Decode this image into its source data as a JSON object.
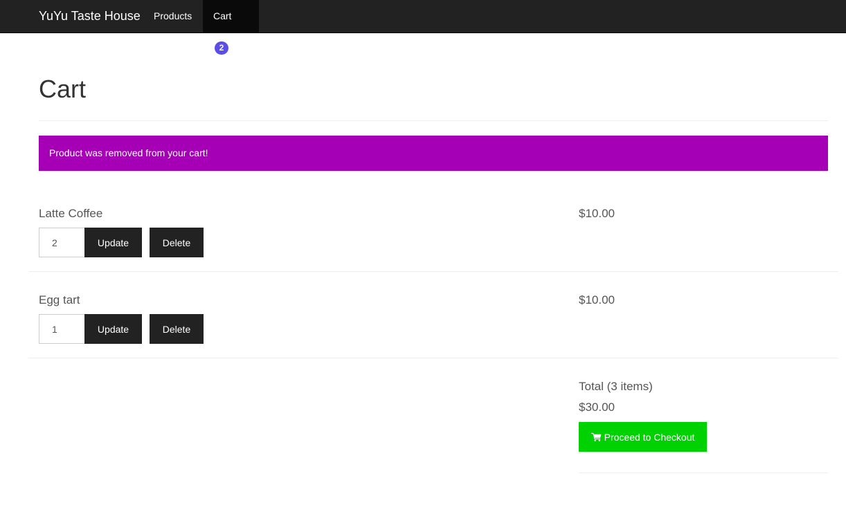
{
  "navbar": {
    "brand": "YuYu Taste House",
    "products_label": "Products",
    "cart_label": "Cart",
    "cart_count": "2"
  },
  "page": {
    "title": "Cart"
  },
  "alert": {
    "message": "Product was removed from your cart!",
    "color": "#a500b5"
  },
  "cart": {
    "items": [
      {
        "name": "Latte Coffee",
        "quantity": "2",
        "price": "$10.00",
        "update_label": "Update",
        "delete_label": "Delete"
      },
      {
        "name": "Egg tart",
        "quantity": "1",
        "price": "$10.00",
        "update_label": "Update",
        "delete_label": "Delete"
      }
    ],
    "total_label": "Total (3 items)",
    "total_value": "$30.00",
    "checkout_label": "Proceed to Checkout",
    "checkout_icon": "shopping-cart-icon",
    "checkout_color": "#00d100",
    "badge_color": "#5b4de6"
  }
}
